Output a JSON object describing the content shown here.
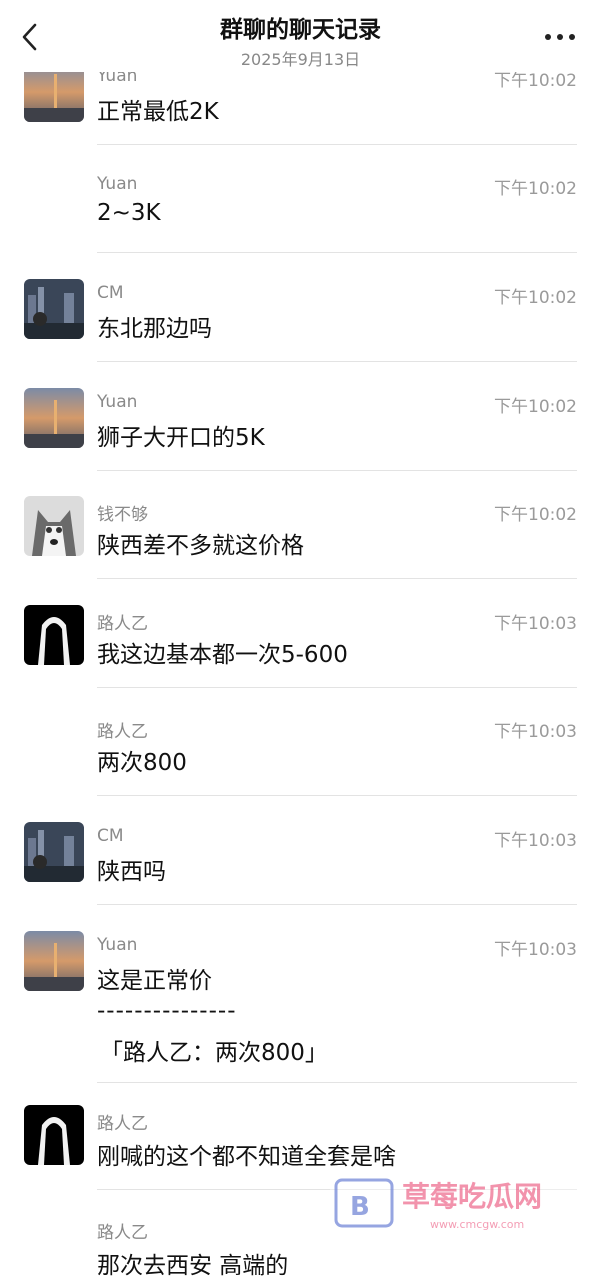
{
  "header": {
    "title": "群聊的聊天记录",
    "date": "2025年9月13日",
    "back_icon": "chevron-left-icon",
    "more_icon": "more-dots-icon"
  },
  "messages": [
    {
      "sender": "Yuan",
      "time": "下午10:02",
      "text": "正常最低2K",
      "avatar": "sunset-avatar"
    },
    {
      "sender": "Yuan",
      "time": "下午10:02",
      "text": "2~3K",
      "avatar": ""
    },
    {
      "sender": "CM",
      "time": "下午10:02",
      "text": "东北那边吗",
      "avatar": "city-night-avatar"
    },
    {
      "sender": "Yuan",
      "time": "下午10:02",
      "text": "狮子大开口的5K",
      "avatar": "sunset-avatar"
    },
    {
      "sender": "钱不够",
      "time": "下午10:02",
      "text": "陕西差不多就这价格",
      "avatar": "husky-avatar"
    },
    {
      "sender": "路人乙",
      "time": "下午10:03",
      "text": "我这边基本都一次5-600",
      "avatar": "hooded-figure-avatar"
    },
    {
      "sender": "路人乙",
      "time": "下午10:03",
      "text": "两次800",
      "avatar": ""
    },
    {
      "sender": "CM",
      "time": "下午10:03",
      "text": "陕西吗",
      "avatar": "city-night-avatar"
    },
    {
      "sender": "Yuan",
      "time": "下午10:03",
      "text": "这是正常价",
      "separator": "---------------",
      "quote": "「路人乙：两次800」",
      "avatar": "sunset-avatar"
    },
    {
      "sender": "路人乙",
      "time": "",
      "text": "刚喊的这个都不知道全套是啥",
      "avatar": "hooded-figure-avatar"
    },
    {
      "sender": "路人乙",
      "time": "",
      "text": "那次去西安  高端的",
      "avatar": ""
    }
  ],
  "watermark": {
    "main": "草莓吃瓜网",
    "sub": "www.cmcgw.com"
  }
}
